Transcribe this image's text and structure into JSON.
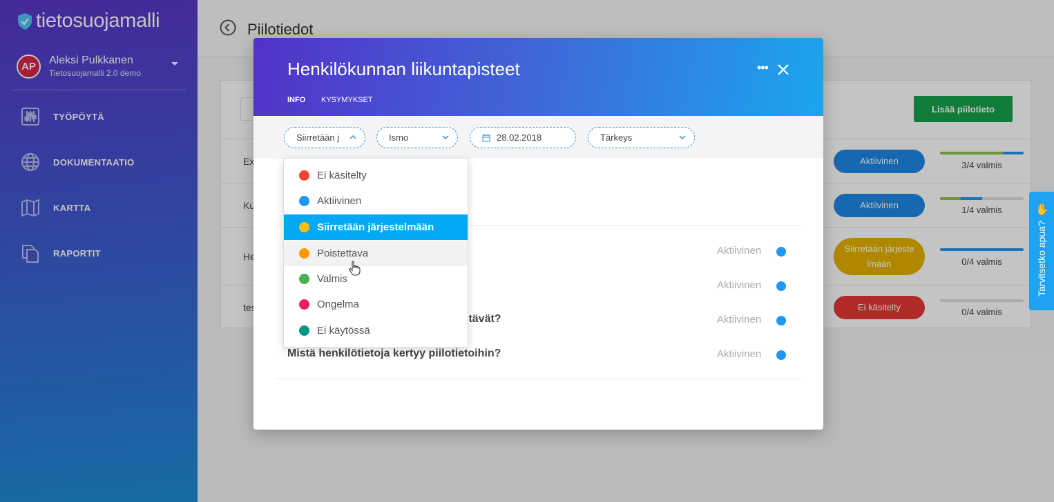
{
  "app": {
    "logo": "tietosuojamalli"
  },
  "user": {
    "initials": "AP",
    "name": "Aleksi Pulkkanen",
    "org": "Tietosuojamalli 2.0 demo"
  },
  "nav": [
    {
      "label": "TYÖPÖYTÄ",
      "icon": "sliders-icon"
    },
    {
      "label": "DOKUMENTAATIO",
      "icon": "globe-icon"
    },
    {
      "label": "KARTTA",
      "icon": "map-icon"
    },
    {
      "label": "RAPORTIT",
      "icon": "documents-icon"
    }
  ],
  "page": {
    "title": "Piilotiedot",
    "add_button": "Lisää piilotieto"
  },
  "rows": [
    {
      "name": "Ex",
      "status": "Aktiivinen",
      "status_color": "#1e88e5",
      "progress_label": "3/4 valmis",
      "green": 0.75,
      "blue": 0.25
    },
    {
      "name": "Ku",
      "status": "Aktiivinen",
      "status_color": "#1e88e5",
      "progress_label": "1/4 valmis",
      "green": 0.25,
      "blue": 0.25
    },
    {
      "name": "He",
      "status": "Siirretään järjeste lmään",
      "status_color": "#e5b100",
      "progress_label": "0/4 valmis",
      "green": 0,
      "blue": 1.0
    },
    {
      "name": "tes",
      "status": "Ei käsitelty",
      "status_color": "#e53935",
      "progress_label": "0/4 valmis",
      "green": 0,
      "blue": 0
    }
  ],
  "help": {
    "label": "Tarvitsetko apua?"
  },
  "modal": {
    "title": "Henkilökunnan liikuntapisteet",
    "tabs": [
      "INFO",
      "KYSYMYKSET"
    ],
    "filters": {
      "status": "Siirretään j",
      "owner": "Ismo",
      "date": "28.02.2018",
      "priority": "Tärkeys"
    },
    "questions": [
      {
        "text": "",
        "status": "Aktiivinen"
      },
      {
        "text": "",
        "status": "Aktiivinen"
      },
      {
        "text": "ltävät?",
        "status": "Aktiivinen"
      },
      {
        "text": "Mistä henkilötietoja kertyy piilotietoihin?",
        "status": "Aktiivinen"
      }
    ]
  },
  "dropdown": {
    "options": [
      {
        "label": "Ei käsitelty",
        "color": "#f44336"
      },
      {
        "label": "Aktiivinen",
        "color": "#2196f3"
      },
      {
        "label": "Siirretään järjestelmään",
        "color": "#ffc107",
        "selected": true
      },
      {
        "label": "Poistettava",
        "color": "#ff9800",
        "hover": true
      },
      {
        "label": "Valmis",
        "color": "#4caf50"
      },
      {
        "label": "Ongelma",
        "color": "#e91e63"
      },
      {
        "label": "Ei käytössä",
        "color": "#009688"
      }
    ]
  }
}
